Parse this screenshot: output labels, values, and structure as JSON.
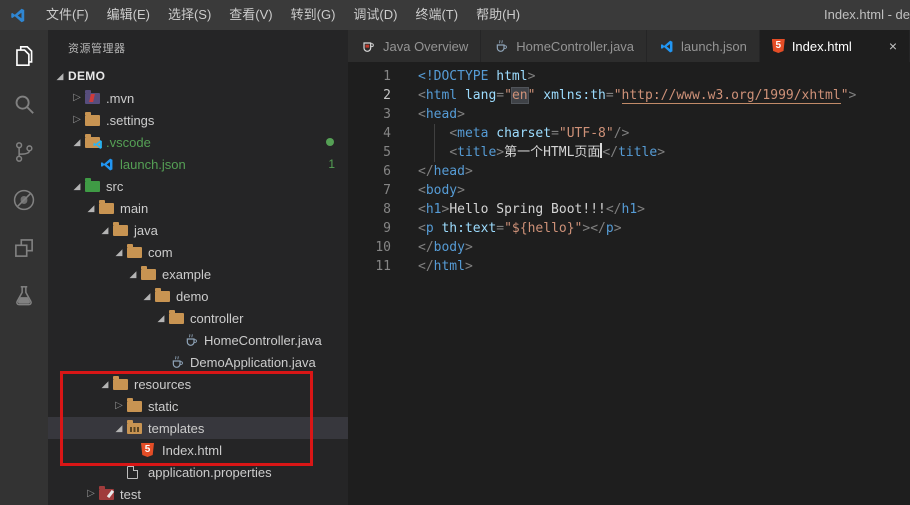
{
  "window": {
    "title_right": "Index.html - de",
    "menus": [
      "文件(F)",
      "编辑(E)",
      "选择(S)",
      "查看(V)",
      "转到(G)",
      "调试(D)",
      "终端(T)",
      "帮助(H)"
    ]
  },
  "activity_bar": {
    "items": [
      {
        "icon": "explorer",
        "active": true
      },
      {
        "icon": "search",
        "active": false
      },
      {
        "icon": "source-control",
        "active": false
      },
      {
        "icon": "debug",
        "active": false
      },
      {
        "icon": "extensions",
        "active": false
      },
      {
        "icon": "test",
        "active": false
      }
    ]
  },
  "explorer": {
    "header": "资源管理器",
    "untracked_color": "#55a055",
    "annotation_color": "#d91616",
    "tree": [
      {
        "label": "DEMO",
        "level": 0,
        "tw": "exp",
        "icon": "none",
        "root": true
      },
      {
        "label": ".mvn",
        "level": 1,
        "tw": "col",
        "icon": "maven"
      },
      {
        "label": ".settings",
        "level": 1,
        "tw": "col",
        "icon": "folder"
      },
      {
        "label": ".vscode",
        "level": 1,
        "tw": "exp",
        "icon": "vscode-folder",
        "green": true,
        "dot": true
      },
      {
        "label": "launch.json",
        "level": 2,
        "tw": "none",
        "icon": "vscode",
        "green": true,
        "badge": "1"
      },
      {
        "label": "src",
        "level": 1,
        "tw": "exp",
        "icon": "src-folder"
      },
      {
        "label": "main",
        "level": 2,
        "tw": "exp",
        "icon": "folder"
      },
      {
        "label": "java",
        "level": 3,
        "tw": "exp",
        "icon": "folder"
      },
      {
        "label": "com",
        "level": 4,
        "tw": "exp",
        "icon": "folder"
      },
      {
        "label": "example",
        "level": 5,
        "tw": "exp",
        "icon": "folder"
      },
      {
        "label": "demo",
        "level": 6,
        "tw": "exp",
        "icon": "folder"
      },
      {
        "label": "controller",
        "level": 7,
        "tw": "exp",
        "icon": "folder"
      },
      {
        "label": "HomeController.java",
        "level": 8,
        "tw": "none",
        "icon": "java"
      },
      {
        "label": "DemoApplication.java",
        "level": 7,
        "tw": "none",
        "icon": "java"
      },
      {
        "label": "resources",
        "level": 3,
        "tw": "exp",
        "icon": "folder"
      },
      {
        "label": "static",
        "level": 4,
        "tw": "col",
        "icon": "folder"
      },
      {
        "label": "templates",
        "level": 4,
        "tw": "exp",
        "icon": "template-folder",
        "selected": true
      },
      {
        "label": "Index.html",
        "level": 5,
        "tw": "none",
        "icon": "html"
      },
      {
        "label": "application.properties",
        "level": 4,
        "tw": "none",
        "icon": "file"
      },
      {
        "label": "test",
        "level": 2,
        "tw": "col",
        "icon": "test-folder"
      }
    ]
  },
  "editor": {
    "tabs": [
      {
        "label": "Java Overview",
        "icon": "java-overview",
        "active": false
      },
      {
        "label": "HomeController.java",
        "icon": "java",
        "active": false
      },
      {
        "label": "launch.json",
        "icon": "vscode",
        "active": false
      },
      {
        "label": "Index.html",
        "icon": "html",
        "active": true,
        "close": "×"
      }
    ],
    "lines": [
      {
        "num": 1,
        "tokens": [
          [
            "tag",
            "<!DOCTYPE"
          ],
          [
            "attr",
            " html"
          ],
          [
            "pun",
            ">"
          ]
        ]
      },
      {
        "num": 2,
        "active": true,
        "tokens": [
          [
            "pun",
            "<"
          ],
          [
            "tag",
            "html"
          ],
          [
            "attr",
            " lang"
          ],
          [
            "pun",
            "="
          ],
          [
            "str",
            "\""
          ],
          [
            "str-hl",
            "en"
          ],
          [
            "str",
            "\""
          ],
          [
            "attr",
            " xmlns:th"
          ],
          [
            "pun",
            "="
          ],
          [
            "str",
            "\""
          ],
          [
            "url",
            "http://www.w3.org/1999/xhtml"
          ],
          [
            "str",
            "\""
          ],
          [
            "pun",
            ">"
          ]
        ]
      },
      {
        "num": 3,
        "tokens": [
          [
            "pun",
            "<"
          ],
          [
            "tag",
            "head"
          ],
          [
            "pun",
            ">"
          ]
        ]
      },
      {
        "num": 4,
        "guide": true,
        "tokens": [
          [
            "txt",
            "    "
          ],
          [
            "pun",
            "<"
          ],
          [
            "tag",
            "meta"
          ],
          [
            "attr",
            " charset"
          ],
          [
            "pun",
            "="
          ],
          [
            "str",
            "\"UTF-8\""
          ],
          [
            "pun",
            "/>"
          ]
        ]
      },
      {
        "num": 5,
        "guide": true,
        "tokens": [
          [
            "txt",
            "    "
          ],
          [
            "pun",
            "<"
          ],
          [
            "tag",
            "title"
          ],
          [
            "pun",
            ">"
          ],
          [
            "txt",
            "第一个HTML页面"
          ],
          [
            "cursor",
            ""
          ],
          [
            "pun",
            "</"
          ],
          [
            "tag",
            "title"
          ],
          [
            "pun",
            ">"
          ]
        ]
      },
      {
        "num": 6,
        "tokens": [
          [
            "pun",
            "</"
          ],
          [
            "tag",
            "head"
          ],
          [
            "pun",
            ">"
          ]
        ]
      },
      {
        "num": 7,
        "tokens": [
          [
            "pun",
            "<"
          ],
          [
            "tag",
            "body"
          ],
          [
            "pun",
            ">"
          ]
        ]
      },
      {
        "num": 8,
        "tokens": [
          [
            "pun",
            "<"
          ],
          [
            "tag",
            "h1"
          ],
          [
            "pun",
            ">"
          ],
          [
            "txt",
            "Hello Spring Boot!!!"
          ],
          [
            "pun",
            "</"
          ],
          [
            "tag",
            "h1"
          ],
          [
            "pun",
            ">"
          ]
        ]
      },
      {
        "num": 9,
        "tokens": [
          [
            "pun",
            "<"
          ],
          [
            "tag",
            "p"
          ],
          [
            "attr",
            " th:text"
          ],
          [
            "pun",
            "="
          ],
          [
            "str",
            "\"${hello}\""
          ],
          [
            "pun",
            ">"
          ],
          [
            "pun",
            "</"
          ],
          [
            "tag",
            "p"
          ],
          [
            "pun",
            ">"
          ]
        ]
      },
      {
        "num": 10,
        "tokens": [
          [
            "pun",
            "</"
          ],
          [
            "tag",
            "body"
          ],
          [
            "pun",
            ">"
          ]
        ]
      },
      {
        "num": 11,
        "tokens": [
          [
            "pun",
            "</"
          ],
          [
            "tag",
            "html"
          ],
          [
            "pun",
            ">"
          ]
        ]
      }
    ]
  }
}
